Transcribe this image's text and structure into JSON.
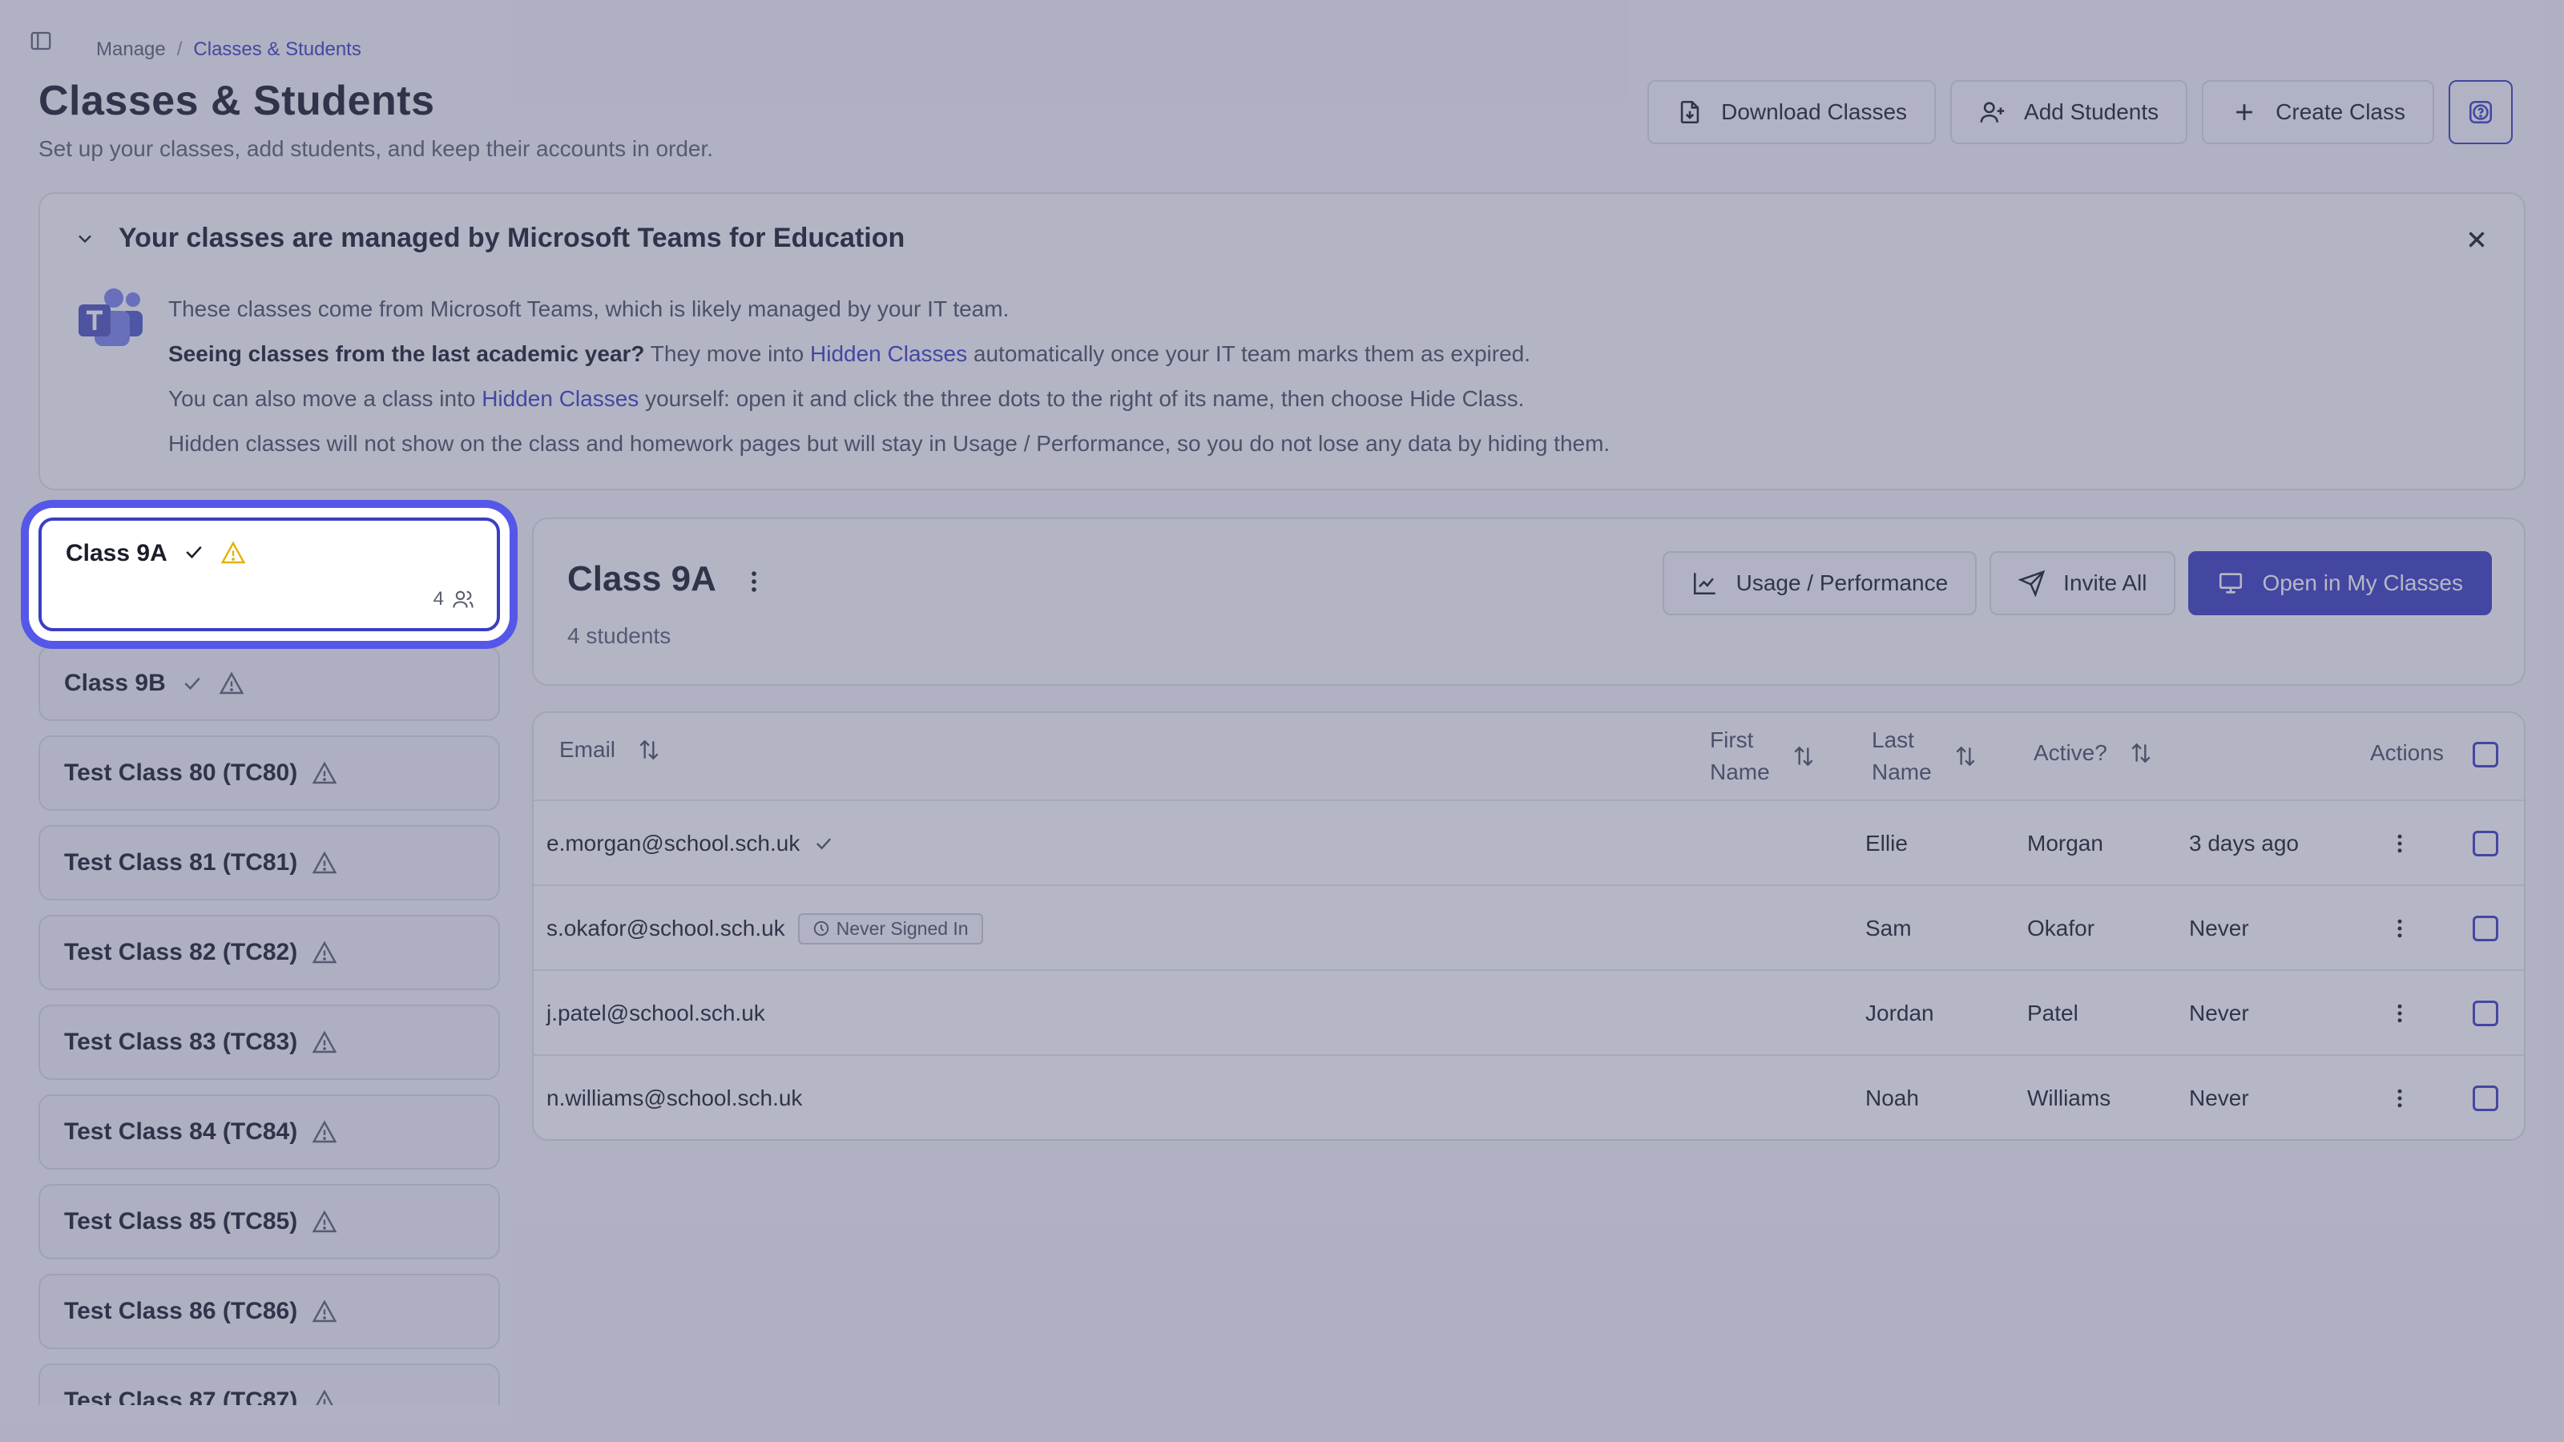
{
  "breadcrumb": {
    "parent": "Manage",
    "separator": "/",
    "current": "Classes & Students"
  },
  "page": {
    "title": "Classes & Students",
    "subtitle": "Set up your classes, add students, and keep their accounts in order."
  },
  "top_actions": {
    "download": "Download Classes",
    "add_students": "Add Students",
    "create_class": "Create Class"
  },
  "banner": {
    "title": "Your classes are managed by Microsoft Teams for Education",
    "line1": "These classes come from Microsoft Teams, which is likely managed by your IT team.",
    "line2_bold": "Seeing classes from the last academic year?",
    "line2_a": " They move into ",
    "line2_link": "Hidden Classes",
    "line2_b": " automatically once your IT team marks them as expired.",
    "line3_a": "You can also move a class into ",
    "line3_link": "Hidden Classes",
    "line3_b": " yourself: open it and click the three dots to the right of its name, then choose Hide Class.",
    "line4": "Hidden classes will not show on the class and homework pages but will stay in Usage / Performance, so you do not lose any data by hiding them."
  },
  "classes": [
    {
      "name": "Class 9A",
      "count": "4"
    },
    {
      "name": "Class 9B"
    },
    {
      "name": "Test Class 80 (TC80)"
    },
    {
      "name": "Test Class 81 (TC81)"
    },
    {
      "name": "Test Class 82 (TC82)"
    },
    {
      "name": "Test Class 83 (TC83)"
    },
    {
      "name": "Test Class 84 (TC84)"
    },
    {
      "name": "Test Class 85 (TC85)"
    },
    {
      "name": "Test Class 86 (TC86)"
    },
    {
      "name": "Test Class 87 (TC87)"
    }
  ],
  "class_detail": {
    "name": "Class 9A",
    "student_count": "4 students",
    "usage": "Usage / Performance",
    "invite": "Invite All",
    "open": "Open in My Classes"
  },
  "table": {
    "headers": {
      "email": "Email",
      "first_name_1": "First",
      "first_name_2": "Name",
      "last_name_1": "Last",
      "last_name_2": "Name",
      "active": "Active?",
      "actions": "Actions"
    },
    "rows": [
      {
        "email": "e.morgan@school.sch.uk",
        "first": "Ellie",
        "last": "Morgan",
        "active": "3 days ago",
        "badge": ""
      },
      {
        "email": "s.okafor@school.sch.uk",
        "first": "Sam",
        "last": "Okafor",
        "active": "Never",
        "badge": "Never Signed In"
      },
      {
        "email": "j.patel@school.sch.uk",
        "first": "Jordan",
        "last": "Patel",
        "active": "Never",
        "badge": ""
      },
      {
        "email": "n.williams@school.sch.uk",
        "first": "Noah",
        "last": "Williams",
        "active": "Never",
        "badge": ""
      }
    ]
  },
  "colors": {
    "accent": "#3a3fc0",
    "warning": "#e0b400",
    "focus_ring": "#5457e8"
  }
}
